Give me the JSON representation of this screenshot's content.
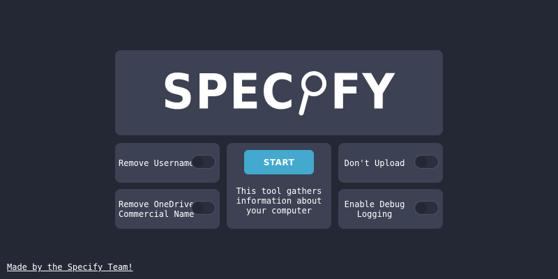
{
  "logo": {
    "text_left": "SPEC",
    "text_right": "FY",
    "glass_icon": "magnifying-glass-icon"
  },
  "options": {
    "remove_username": {
      "label": "Remove Username",
      "enabled": false
    },
    "remove_onedrive": {
      "label": "Remove OneDrive\nCommercial Name",
      "enabled": false
    },
    "dont_upload": {
      "label": "Don't Upload",
      "enabled": false
    },
    "debug_logging": {
      "label": "Enable Debug\nLogging",
      "enabled": false
    }
  },
  "start": {
    "label": "START",
    "description": "This tool gathers\ninformation about\nyour computer"
  },
  "footer": {
    "link_text": "Made by the Specify Team!"
  },
  "colors": {
    "background": "#242835",
    "panel": "#3c4253",
    "accent": "#42a9cf",
    "toggle_track": "#2a2f3d",
    "text": "#ffffff"
  }
}
